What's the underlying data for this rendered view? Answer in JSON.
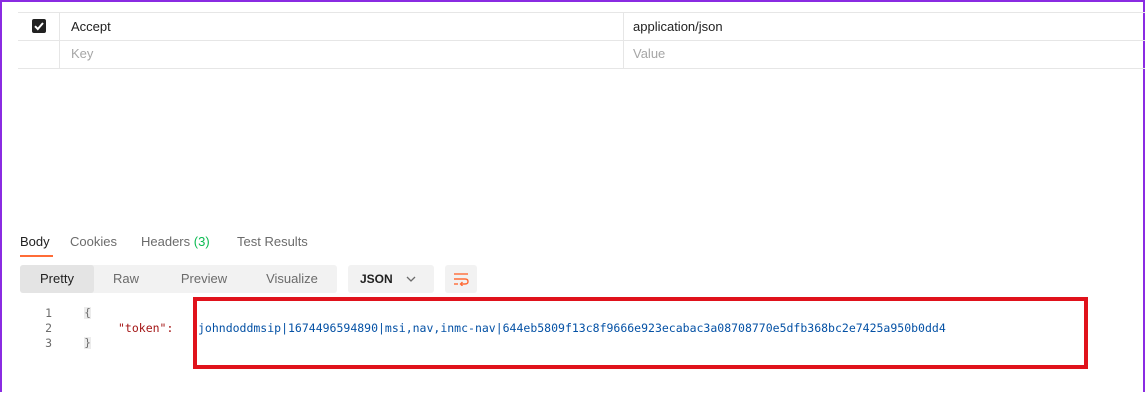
{
  "headers_table": {
    "rows": [
      {
        "key": "Accept",
        "value": "application/json",
        "checked": true
      },
      {
        "key_placeholder": "Key",
        "value_placeholder": "Value"
      }
    ]
  },
  "response": {
    "tabs": [
      {
        "label": "Body"
      },
      {
        "label": "Cookies"
      },
      {
        "label": "Headers",
        "count": "(3)"
      },
      {
        "label": "Test Results"
      }
    ],
    "view_modes": [
      "Pretty",
      "Raw",
      "Preview",
      "Visualize"
    ],
    "active_view": "Pretty",
    "format": "JSON",
    "code": {
      "line_numbers": [
        "1",
        "2",
        "3"
      ],
      "open_brace": "{",
      "close_brace": "}",
      "key": "\"token\":",
      "value": "johndoddmsip|1674496594890|msi,nav,inmc-nav|644eb5809f13c8f9666e923ecabac3a08708770e5dfb368bc2e7425a950b0dd4"
    }
  },
  "colors": {
    "accent_tab": "#ff6c37",
    "count_green": "#0cbb52",
    "highlight_red": "#e0121b",
    "frame_purple": "#8a2be2"
  }
}
